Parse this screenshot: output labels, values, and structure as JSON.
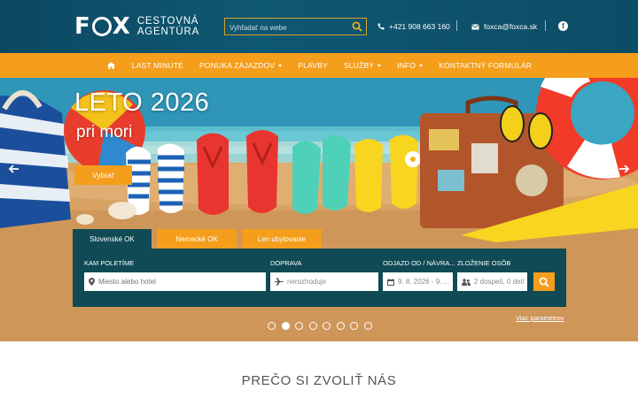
{
  "header": {
    "logo": {
      "mark": "FOX",
      "line1": "CESTOVNÁ",
      "line2": "AGENTÚRA"
    },
    "search": {
      "placeholder": "Vyhľadať na webe",
      "icon": "search-icon"
    },
    "phone": {
      "icon": "phone-icon",
      "text": "+421 908 663 160"
    },
    "email": {
      "icon": "envelope-icon",
      "text": "foxca@foxca.sk"
    },
    "social": {
      "icon": "facebook-icon",
      "label": "f"
    }
  },
  "nav": {
    "home_icon": "home-icon",
    "items": [
      {
        "label": "LAST MINUTE",
        "dropdown": false
      },
      {
        "label": "PONUKA ZÁJAZDOV",
        "dropdown": true
      },
      {
        "label": "PLAVBY",
        "dropdown": false
      },
      {
        "label": "SLUŽBY",
        "dropdown": true
      },
      {
        "label": "INFO",
        "dropdown": true
      },
      {
        "label": "KONTAKTNÝ FORMULÁR",
        "dropdown": false
      }
    ]
  },
  "hero": {
    "title": "LETO 2026",
    "subtitle": "pri mori",
    "cta": "Vybrať",
    "prev_icon": "arrow-left-icon",
    "next_icon": "arrow-right-icon",
    "slide_count": 8,
    "active_slide": 2
  },
  "search_widget": {
    "tabs": [
      {
        "label": "Slovenské OK",
        "active": true
      },
      {
        "label": "Nemecké OK",
        "active": false
      },
      {
        "label": "Len ubytovanie",
        "active": false
      }
    ],
    "fields": {
      "destination": {
        "label": "KAM POLETÍME",
        "placeholder": "Miesto alebo hotel",
        "icon": "map-pin-icon"
      },
      "transport": {
        "label": "DOPRAVA",
        "value": "nerozhoduje",
        "icon": "airplane-icon"
      },
      "dates": {
        "label": "ODJAZD OD / NÁVRA...",
        "value": "9. 8. 2026 - 9. ...",
        "icon": "calendar-icon"
      },
      "persons": {
        "label": "ZLOŽENIE OSÔB",
        "value": "2 dospelí, 0 detí",
        "icon": "people-icon"
      }
    },
    "submit_icon": "search-icon",
    "advanced_link": "Viac parametrov"
  },
  "why_section": {
    "heading": "PREČO SI ZVOLIŤ NÁS"
  },
  "colors": {
    "header_bg": "#0f5872",
    "accent": "#f59e1b",
    "panel_bg": "#0f4a55"
  }
}
